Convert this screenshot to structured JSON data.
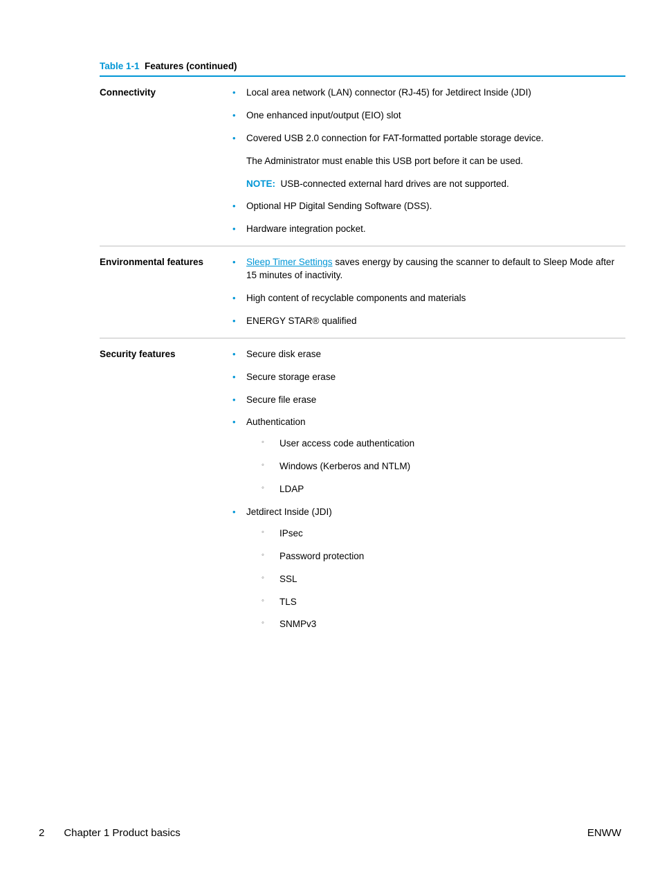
{
  "caption": {
    "number": "Table 1-1",
    "title": "Features (continued)"
  },
  "rows": {
    "connectivity": {
      "label": "Connectivity",
      "b1": "Local area network (LAN) connector (RJ-45) for Jetdirect Inside (JDI)",
      "b2": "One enhanced input/output (EIO) slot",
      "b3": "Covered USB 2.0 connection for FAT-formatted portable storage device.",
      "p1": "The Administrator must enable this USB port before it can be used.",
      "note_label": "NOTE:",
      "note_text": "USB-connected external hard drives are not supported.",
      "b4": "Optional HP Digital Sending Software (DSS).",
      "b5": "Hardware integration pocket."
    },
    "environmental": {
      "label": "Environmental features",
      "b1_link": "Sleep Timer Settings",
      "b1_rest": " saves energy by causing the scanner to default to Sleep Mode after 15 minutes of inactivity.",
      "b2": "High content of recyclable components and materials",
      "b3": "ENERGY STAR® qualified"
    },
    "security": {
      "label": "Security features",
      "b1": "Secure disk erase",
      "b2": "Secure storage erase",
      "b3": "Secure file erase",
      "b4": "Authentication",
      "b4s1": "User access code authentication",
      "b4s2": "Windows (Kerberos and NTLM)",
      "b4s3": "LDAP",
      "b5": "Jetdirect Inside (JDI)",
      "b5s1": "IPsec",
      "b5s2": "Password protection",
      "b5s3": "SSL",
      "b5s4": "TLS",
      "b5s5": "SNMPv3"
    }
  },
  "footer": {
    "page": "2",
    "chapter": "Chapter 1   Product basics",
    "lang": "ENWW"
  }
}
